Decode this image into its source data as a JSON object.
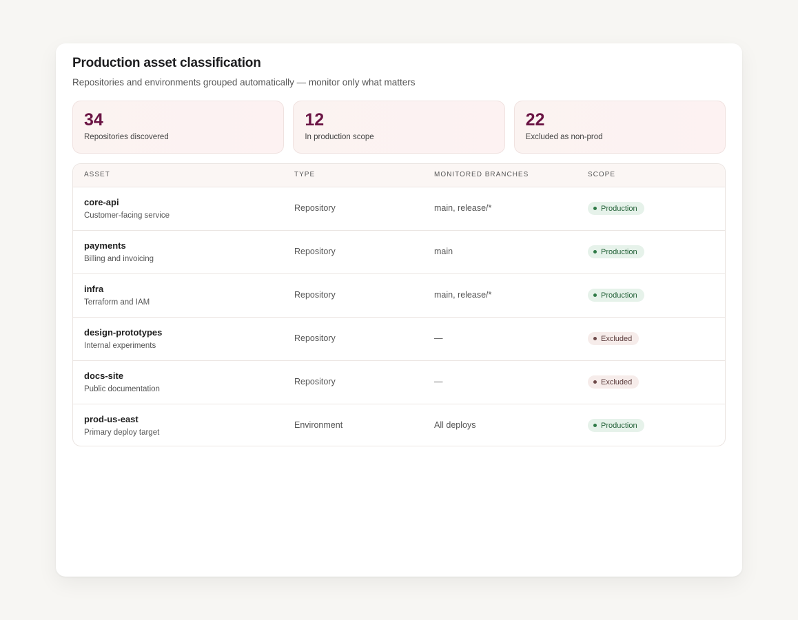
{
  "header": {
    "title": "Production asset classification",
    "subtitle": "Repositories and environments grouped automatically — monitor only what matters"
  },
  "stats": [
    {
      "value": "34",
      "label": "Repositories discovered"
    },
    {
      "value": "12",
      "label": "In production scope"
    },
    {
      "value": "22",
      "label": "Excluded as non-prod"
    }
  ],
  "table": {
    "headers": {
      "asset": "ASSET",
      "type": "TYPE",
      "branches": "MONITORED BRANCHES",
      "scope": "SCOPE"
    },
    "rows": [
      {
        "name": "core-api",
        "desc": "Customer-facing service",
        "type": "Repository",
        "branches": "main, release/*",
        "scope": "Production",
        "scope_kind": "prod"
      },
      {
        "name": "payments",
        "desc": "Billing and invoicing",
        "type": "Repository",
        "branches": "main",
        "scope": "Production",
        "scope_kind": "prod"
      },
      {
        "name": "infra",
        "desc": "Terraform and IAM",
        "type": "Repository",
        "branches": "main, release/*",
        "scope": "Production",
        "scope_kind": "prod"
      },
      {
        "name": "design-prototypes",
        "desc": "Internal experiments",
        "type": "Repository",
        "branches": "—",
        "scope": "Excluded",
        "scope_kind": "excl"
      },
      {
        "name": "docs-site",
        "desc": "Public documentation",
        "type": "Repository",
        "branches": "—",
        "scope": "Excluded",
        "scope_kind": "excl"
      },
      {
        "name": "prod-us-east",
        "desc": "Primary deploy target",
        "type": "Environment",
        "branches": "All deploys",
        "scope": "Production",
        "scope_kind": "prod"
      }
    ]
  },
  "colors": {
    "accent": "#6a1444",
    "production_badge_bg": "#e6f2ea",
    "production_badge_text": "#1f5e34",
    "excluded_badge_bg": "#f6ecea",
    "excluded_badge_text": "#5a3a3a"
  }
}
